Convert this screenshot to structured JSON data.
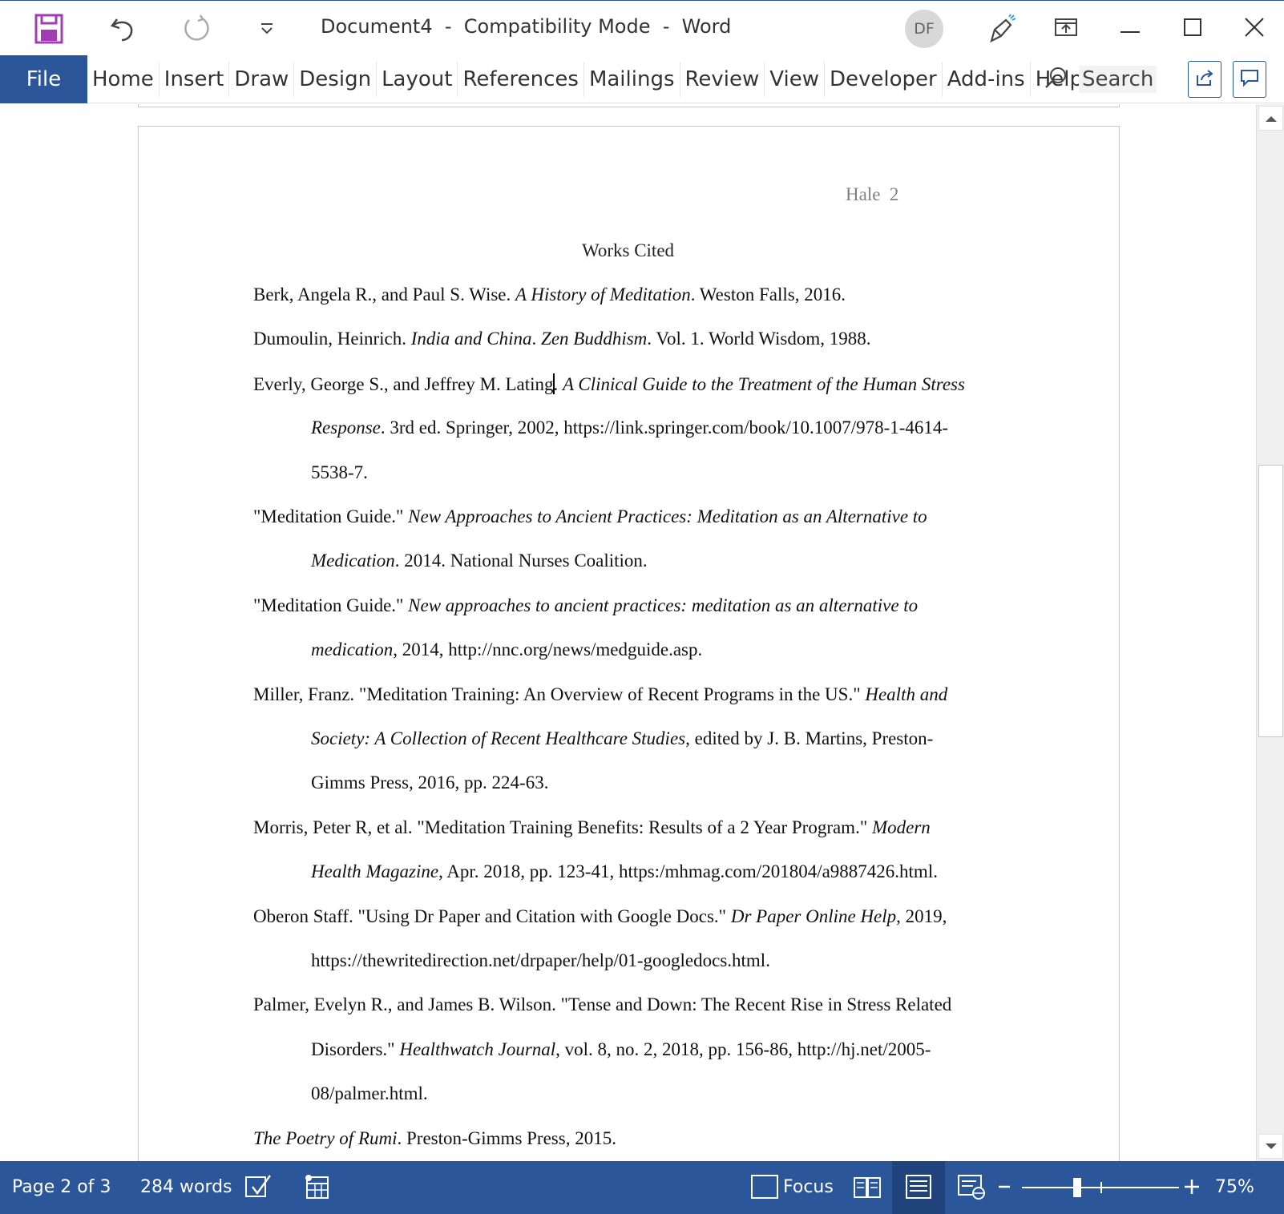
{
  "titlebar": {
    "title": "Document4  -  Compatibility Mode  -  Word",
    "avatar_initials": "DF",
    "icons": [
      "save-icon",
      "undo-icon",
      "redo-icon",
      "customize-toolbar-icon",
      "designer-icon",
      "ribbon-display-icon",
      "minimize-icon",
      "maximize-icon",
      "close-icon"
    ]
  },
  "ribbon": {
    "file_label": "File",
    "tabs": [
      "Home",
      "Insert",
      "Draw",
      "Design",
      "Layout",
      "References",
      "Mailings",
      "Review",
      "View",
      "Developer",
      "Add-ins",
      "Help"
    ],
    "search_label": "Search"
  },
  "document": {
    "header_text": "Hale  2",
    "heading": "Works Cited",
    "lines": [
      [
        {
          "t": "Berk, Angela R., and Paul S. Wise. ",
          "i": false
        },
        {
          "t": "A History of Meditation",
          "i": true
        },
        {
          "t": ". Weston Falls, 2016.",
          "i": false
        }
      ],
      [
        {
          "t": "Dumoulin, Heinrich. ",
          "i": false
        },
        {
          "t": "India and China",
          "i": true
        },
        {
          "t": ". ",
          "i": false
        },
        {
          "t": "Zen Buddhism",
          "i": true
        },
        {
          "t": ". Vol. 1. World Wisdom, 1988.",
          "i": false
        }
      ],
      [
        {
          "t": "Everly, George S., and Jeffrey M. Lating",
          "i": false
        },
        {
          "t": "CARET"
        },
        {
          "t": ". ",
          "i": false
        },
        {
          "t": "A Clinical Guide to the Treatment of the Human Stress",
          "i": true
        }
      ],
      [
        {
          "t": "Response",
          "i": true
        },
        {
          "t": ". 3rd ed. Springer, 2002, https://link.springer.com/book/10.1007/978-1-4614-",
          "i": false
        }
      ],
      [
        {
          "t": "5538-7.",
          "i": false
        }
      ],
      [
        {
          "t": "\"Meditation Guide.\" ",
          "i": false
        },
        {
          "t": "New Approaches to Ancient Practices: Meditation as an Alternative to",
          "i": true
        }
      ],
      [
        {
          "t": "Medication",
          "i": true
        },
        {
          "t": ". 2014. National Nurses Coalition.",
          "i": false
        }
      ],
      [
        {
          "t": "\"Meditation Guide.\" ",
          "i": false
        },
        {
          "t": "New approaches to ancient practices: meditation as an alternative to",
          "i": true
        }
      ],
      [
        {
          "t": "medication",
          "i": true
        },
        {
          "t": ", 2014, http://nnc.org/news/medguide.asp.",
          "i": false
        }
      ],
      [
        {
          "t": "Miller, Franz. \"Meditation Training: An Overview of Recent Programs in the US.\" ",
          "i": false
        },
        {
          "t": "Health and",
          "i": true
        }
      ],
      [
        {
          "t": "Society: A Collection of Recent Healthcare Studies",
          "i": true
        },
        {
          "t": ", edited by J. B. Martins, Preston-",
          "i": false
        }
      ],
      [
        {
          "t": "Gimms Press, 2016, pp. 224-63.",
          "i": false
        }
      ],
      [
        {
          "t": "Morris, Peter R, et al. \"Meditation Training Benefits: Results of a 2 Year Program.\" ",
          "i": false
        },
        {
          "t": "Modern",
          "i": true
        }
      ],
      [
        {
          "t": "Health Magazine",
          "i": true
        },
        {
          "t": ", Apr. 2018, pp. 123-41, https:/mhmag.com/201804/a9887426.html.",
          "i": false
        }
      ],
      [
        {
          "t": "Oberon Staff. \"Using Dr Paper and Citation with Google Docs.\" ",
          "i": false
        },
        {
          "t": "Dr Paper Online Help",
          "i": true
        },
        {
          "t": ", 2019,",
          "i": false
        }
      ],
      [
        {
          "t": "https://thewritedirection.net/drpaper/help/01-googledocs.html.",
          "i": false
        }
      ],
      [
        {
          "t": "Palmer, Evelyn R., and James B. Wilson. \"Tense and Down: The Recent Rise in Stress Related",
          "i": false
        }
      ],
      [
        {
          "t": "Disorders.\" ",
          "i": false
        },
        {
          "t": "Healthwatch Journal",
          "i": true
        },
        {
          "t": ", vol. 8, no. 2, 2018, pp. 156-86, http://hj.net/2005-",
          "i": false
        }
      ],
      [
        {
          "t": "08/palmer.html.",
          "i": false
        }
      ],
      [
        {
          "t": "The Poetry of Rumi",
          "i": true
        },
        {
          "t": ". Preston-Gimms Press, 2015.",
          "i": false
        }
      ]
    ],
    "indented": [
      false,
      false,
      false,
      true,
      true,
      false,
      true,
      false,
      true,
      false,
      true,
      true,
      false,
      true,
      false,
      true,
      false,
      true,
      true,
      false
    ]
  },
  "statusbar": {
    "page_info": "Page 2 of 3",
    "word_count": "284 words",
    "focus_label": "Focus",
    "zoom_level": "75%",
    "zoom_fraction": 0.35
  },
  "colors": {
    "accent": "#2b579a",
    "save_icon": "#a23cb5"
  }
}
